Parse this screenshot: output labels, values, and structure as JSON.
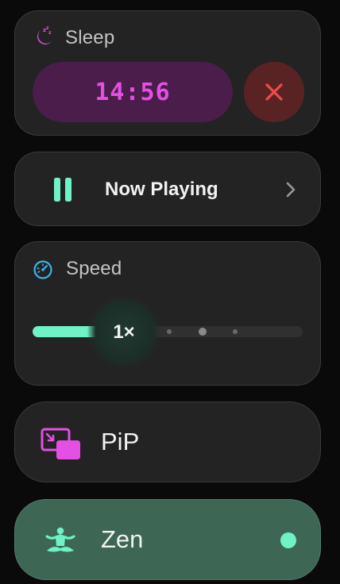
{
  "sleep": {
    "label": "Sleep",
    "time": "14:56",
    "icon": "moon-zzz-icon",
    "cancel_icon": "close-icon"
  },
  "now_playing": {
    "label": "Now Playing",
    "state_icon": "pause-icon",
    "chevron_icon": "chevron-right-icon"
  },
  "speed": {
    "label": "Speed",
    "value": "1×",
    "fill_fraction": 0.29,
    "icon": "gauge-icon"
  },
  "pip": {
    "label": "PiP",
    "icon": "picture-in-picture-icon"
  },
  "zen": {
    "label": "Zen",
    "icon": "meditation-icon",
    "active": true
  },
  "colors": {
    "accent": "#6ef2c6",
    "magenta": "#e54fe3",
    "danger": "#ef4a4a",
    "zen_bg": "#3d6655"
  }
}
